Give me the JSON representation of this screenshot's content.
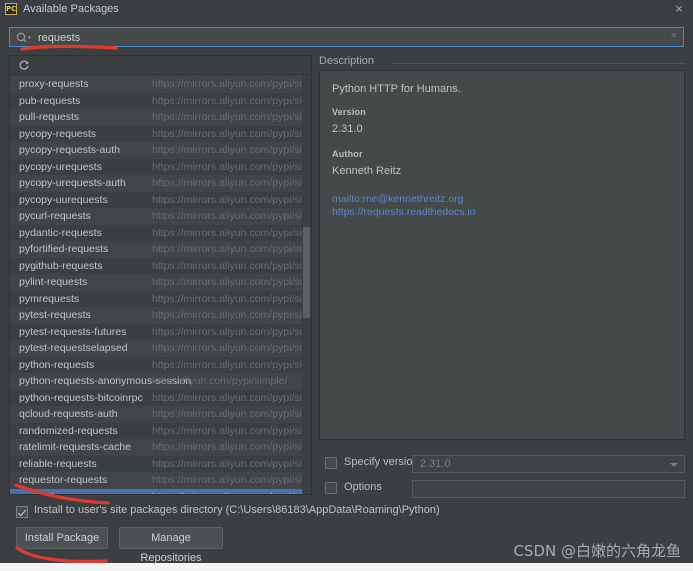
{
  "window": {
    "title": "Available Packages",
    "icon": "pycharm-icon",
    "close_label": "×"
  },
  "search": {
    "value": "requests",
    "placeholder": "",
    "icon": "search-icon",
    "clear_label": "×"
  },
  "list": {
    "toolbar_icon": "refresh-icon",
    "selected": "requests",
    "items": [
      {
        "name": "proxy-requests",
        "url": "https://mirrors.aliyun.com/pypi/simple/"
      },
      {
        "name": "pub-requests",
        "url": "https://mirrors.aliyun.com/pypi/simple/"
      },
      {
        "name": "pull-requests",
        "url": "https://mirrors.aliyun.com/pypi/simple/"
      },
      {
        "name": "pycopy-requests",
        "url": "https://mirrors.aliyun.com/pypi/simple/"
      },
      {
        "name": "pycopy-requests-auth",
        "url": "https://mirrors.aliyun.com/pypi/simple/"
      },
      {
        "name": "pycopy-urequests",
        "url": "https://mirrors.aliyun.com/pypi/simple/"
      },
      {
        "name": "pycopy-urequests-auth",
        "url": "https://mirrors.aliyun.com/pypi/simple/"
      },
      {
        "name": "pycopy-uurequests",
        "url": "https://mirrors.aliyun.com/pypi/simple/"
      },
      {
        "name": "pycurl-requests",
        "url": "https://mirrors.aliyun.com/pypi/simple/"
      },
      {
        "name": "pydantic-requests",
        "url": "https://mirrors.aliyun.com/pypi/simple/"
      },
      {
        "name": "pyfortified-requests",
        "url": "https://mirrors.aliyun.com/pypi/simple/"
      },
      {
        "name": "pygithub-requests",
        "url": "https://mirrors.aliyun.com/pypi/simple/"
      },
      {
        "name": "pylint-requests",
        "url": "https://mirrors.aliyun.com/pypi/simple/"
      },
      {
        "name": "pymrequests",
        "url": "https://mirrors.aliyun.com/pypi/simple/"
      },
      {
        "name": "pytest-requests",
        "url": "https://mirrors.aliyun.com/pypi/simple/"
      },
      {
        "name": "pytest-requests-futures",
        "url": "https://mirrors.aliyun.com/pypi/simple/"
      },
      {
        "name": "pytest-requestselapsed",
        "url": "https://mirrors.aliyun.com/pypi/simple/"
      },
      {
        "name": "python-requests",
        "url": "https://mirrors.aliyun.com/pypi/simple/"
      },
      {
        "name": "python-requests-anonymous-session",
        "url": "irrors.aliyun.com/pypi/simple/"
      },
      {
        "name": "python-requests-bitcoinrpc",
        "url": "https://mirrors.aliyun.com/pypi/simple/"
      },
      {
        "name": "qcloud-requests-auth",
        "url": "https://mirrors.aliyun.com/pypi/simple/"
      },
      {
        "name": "randomized-requests",
        "url": "https://mirrors.aliyun.com/pypi/simple/"
      },
      {
        "name": "ratelimit-requests-cache",
        "url": "https://mirrors.aliyun.com/pypi/simple/"
      },
      {
        "name": "reliable-requests",
        "url": "https://mirrors.aliyun.com/pypi/simple/"
      },
      {
        "name": "requestor-requests",
        "url": "https://mirrors.aliyun.com/pypi/simple/"
      },
      {
        "name": "requests",
        "url": "https://mirrors.aliyun.com/pypi/simple/"
      }
    ]
  },
  "description": {
    "legend": "Description",
    "summary": "Python HTTP for Humans.",
    "version_label": "Version",
    "version_value": "2.31.0",
    "author_label": "Author",
    "author_value": "Kenneth Reitz",
    "links": [
      "mailto:me@kennethreitz.org",
      "https://requests.readthedocs.io"
    ]
  },
  "options": {
    "specify_version_label": "Specify version",
    "specify_version_checked": false,
    "specify_version_value": "2.31.0",
    "options_label": "Options",
    "options_checked": false,
    "options_value": ""
  },
  "footer": {
    "install_user_site_label": "Install to user's site packages directory (C:\\Users\\86183\\AppData\\Roaming\\Python)",
    "install_user_site_checked": true,
    "install_button": "Install Package",
    "manage_button": "Manage Repositories"
  },
  "watermark": "CSDN @白嫩的六角龙鱼",
  "colors": {
    "accent": "#4b6eaf",
    "border_focus": "#4a88c7",
    "link": "#5b87c9",
    "annotation": "#e03a2f"
  }
}
